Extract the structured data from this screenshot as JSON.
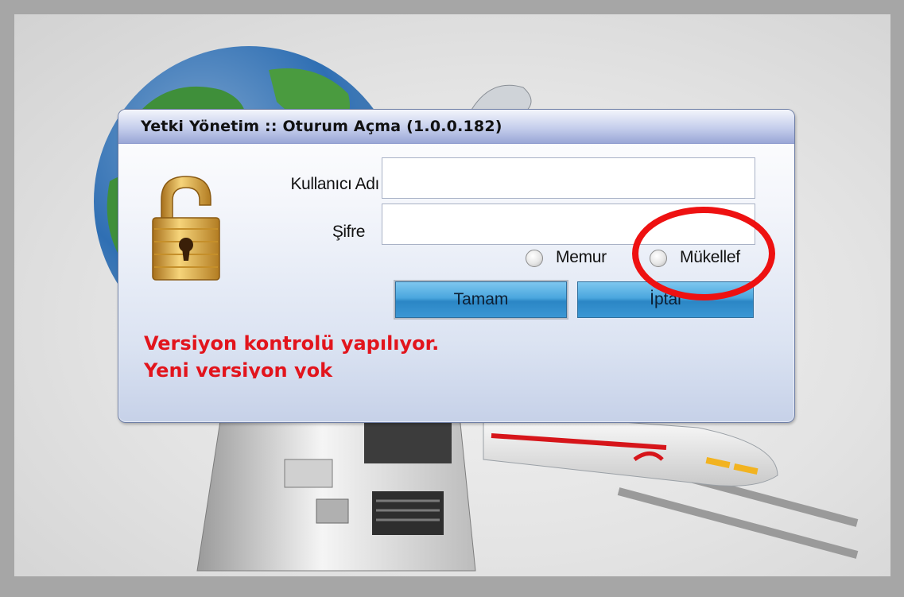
{
  "window": {
    "title": "Yetki Yönetim :: Oturum Açma (1.0.0.182)"
  },
  "form": {
    "username_label": "Kullanıcı Adı",
    "username_value": "",
    "password_label": "Şifre",
    "password_value": "",
    "user_type_options": [
      {
        "label": "Memur",
        "selected": false
      },
      {
        "label": "Mükellef",
        "selected": false
      }
    ]
  },
  "buttons": {
    "ok_label": "Tamam",
    "cancel_label": "İptal"
  },
  "status": {
    "line1": "Versiyon kontrolü yapılıyor.",
    "line2": "Yeni versiyon yok"
  },
  "icons": {
    "lock": "open-padlock-icon",
    "highlight": "red-circle-annotation"
  },
  "colors": {
    "status_text": "#e2141c",
    "button_blue": "#3b97d4",
    "annotation_red": "#ee1111"
  }
}
